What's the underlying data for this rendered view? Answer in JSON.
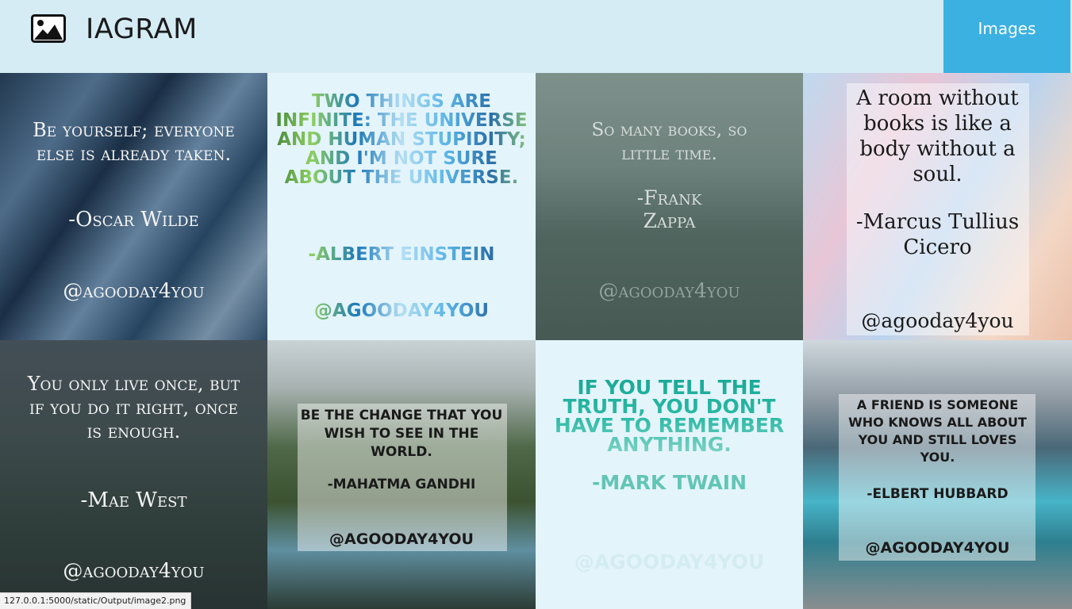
{
  "header": {
    "brand": "IAGRAM",
    "brand_icon": "image-icon",
    "nav_button": "Images"
  },
  "tiles": [
    {
      "quote": "Be yourself; everyone else is already taken.",
      "author": "-Oscar Wilde",
      "handle": "@agooday4you"
    },
    {
      "quote": "Two things are infinite: the universe and human stupidity; and I'm not sure about the universe.",
      "author": "-Albert Einstein",
      "handle": "@agooday4you"
    },
    {
      "quote": "So many books, so little time.",
      "author": "-Frank Zappa",
      "handle": "@agooday4you"
    },
    {
      "quote": "A room without books is like a body without a soul.",
      "author": "-Marcus Tullius Cicero",
      "handle": "@agooday4you"
    },
    {
      "quote": "You only live once, but if you do it right, once is enough.",
      "author": "-Mae West",
      "handle": "@agooday4you"
    },
    {
      "quote": "Be the change that you wish to see in the world.",
      "author": "-Mahatma Gandhi",
      "handle": "@agooday4you"
    },
    {
      "quote": "If you tell the truth, you don't have to remember anything.",
      "author": "-Mark Twain",
      "handle": "@agooday4you"
    },
    {
      "quote": "A friend is someone who knows all about you and still loves you.",
      "author": "-Elbert Hubbard",
      "handle": "@agooday4you"
    }
  ],
  "status_bar": {
    "url": "127.0.0.1:5000/static/Output/image2.png"
  },
  "colors": {
    "header_bg": "#d6ecf5",
    "nav_button_bg": "#3bb1e2",
    "tile_light_bg": "#e4f4fb"
  }
}
